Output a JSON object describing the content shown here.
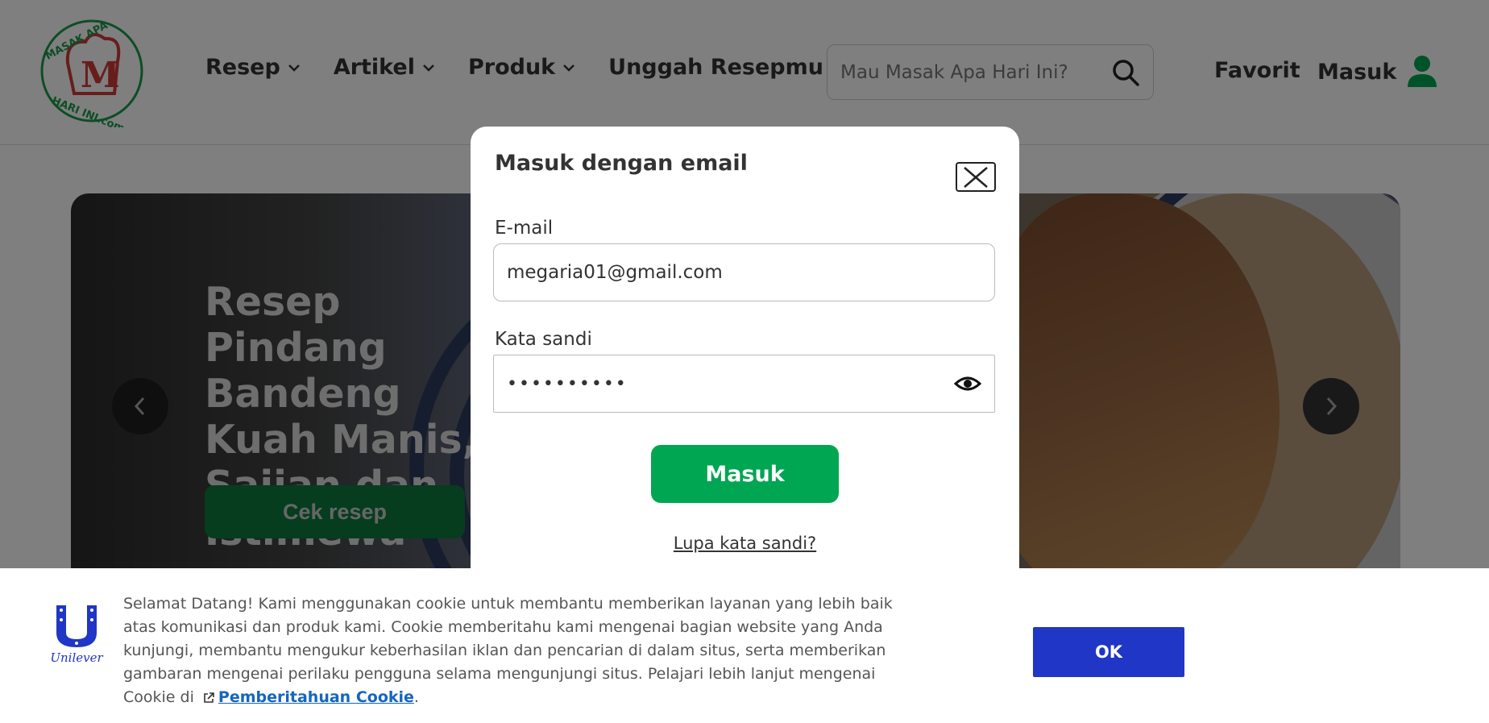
{
  "header": {
    "logo_text_top": "MASAK APA",
    "logo_text_bottom": "HARI INI.com",
    "nav": [
      {
        "label": "Resep",
        "has_dropdown": true
      },
      {
        "label": "Artikel",
        "has_dropdown": true
      },
      {
        "label": "Produk",
        "has_dropdown": true
      },
      {
        "label": "Unggah Resepmu",
        "has_dropdown": false
      }
    ],
    "search": {
      "placeholder": "Mau Masak Apa Hari Ini?",
      "value": ""
    },
    "favorit_label": "Favorit",
    "masuk_label": "Masuk"
  },
  "hero": {
    "title": "Resep Pindang Bandeng Kuah Manis, Sajian dan Istimewa",
    "button_label": "Cek resep"
  },
  "modal": {
    "title": "Masuk dengan email",
    "email_label": "E-mail",
    "email_value": "megaria01@gmail.com",
    "password_label": "Kata sandi",
    "password_value": "••••••••••",
    "submit_label": "Masuk",
    "forgot_label": "Lupa kata sandi?"
  },
  "cookie": {
    "brand": "Unilever",
    "text": "Selamat Datang! Kami menggunakan cookie untuk membantu memberikan layanan yang lebih baik atas komunikasi dan produk kami. Cookie memberitahu kami mengenai bagian website yang Anda kunjungi, membantu mengukur keberhasilan iklan dan pencarian di dalam situs, serta memberikan gambaran mengenai perilaku pengguna selama mengunjungi situs. Pelajari lebih lanjut mengenai Cookie di",
    "link_label": "Pemberitahuan Cookie",
    "link_suffix": ".",
    "ok_label": "OK"
  },
  "colors": {
    "brand_green": "#00a651",
    "cookie_blue": "#1f36c7",
    "link_blue": "#1565c0"
  }
}
